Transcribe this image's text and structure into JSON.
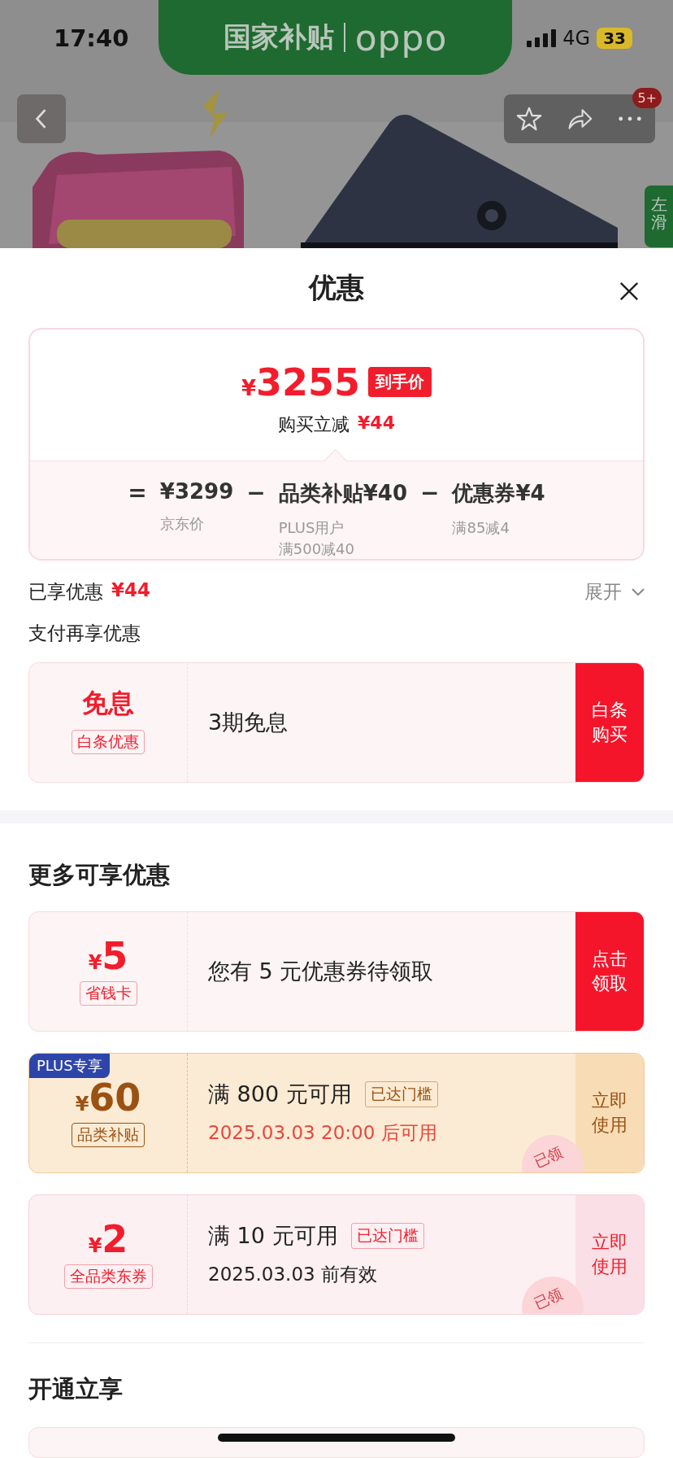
{
  "status_bar": {
    "time": "17:40",
    "network": "4G",
    "battery": "33"
  },
  "background": {
    "banner_text": "国家补贴",
    "brand": "oppo",
    "badge": "5+",
    "side_tab": "左滑"
  },
  "sheet": {
    "title": "优惠",
    "price_card": {
      "currency": "¥",
      "price": "3255",
      "price_tag": "到手价",
      "discount_label": "购买立减",
      "discount_value": "¥44",
      "breakdown": [
        {
          "operator": "=",
          "amount": "¥3299",
          "notes": [
            "京东价"
          ]
        },
        {
          "operator": "−",
          "label": "品类补贴",
          "amount": "¥40",
          "notes": [
            "PLUS用户",
            "满500减40"
          ]
        },
        {
          "operator": "−",
          "label": "优惠券",
          "amount": "¥4",
          "notes": [
            "满85减4"
          ]
        }
      ]
    },
    "enjoyed": {
      "label": "已享优惠",
      "amount": "¥44",
      "toggle": "展开",
      "expanded": false
    },
    "pay_section": {
      "title": "支付再享优惠",
      "coupons": [
        {
          "kind": "red",
          "value": "免息",
          "tag": "白条优惠",
          "headline": "3期免息",
          "action": "白条购买"
        }
      ]
    },
    "more_section": {
      "title": "更多可享优惠",
      "coupons": [
        {
          "kind": "red",
          "currency": "¥",
          "value": "5",
          "tag": "省钱卡",
          "headline": "您有 5 元优惠券待领取",
          "action": "点击领取"
        },
        {
          "kind": "gold",
          "corner": "PLUS专享",
          "currency": "¥",
          "value": "60",
          "tag": "品类补贴",
          "headline": "满 800 元可用",
          "threshold": "已达门槛",
          "subline": "2025.03.03 20:00 后可用",
          "action": "立即使用",
          "stamp": "已领"
        },
        {
          "kind": "pink",
          "currency": "¥",
          "value": "2",
          "tag": "全品类东券",
          "headline": "满 10 元可用",
          "threshold": "已达门槛",
          "subline": "2025.03.03 前有效",
          "action": "立即使用",
          "stamp": "已领"
        }
      ]
    },
    "open_section": {
      "title": "开通立享"
    }
  }
}
